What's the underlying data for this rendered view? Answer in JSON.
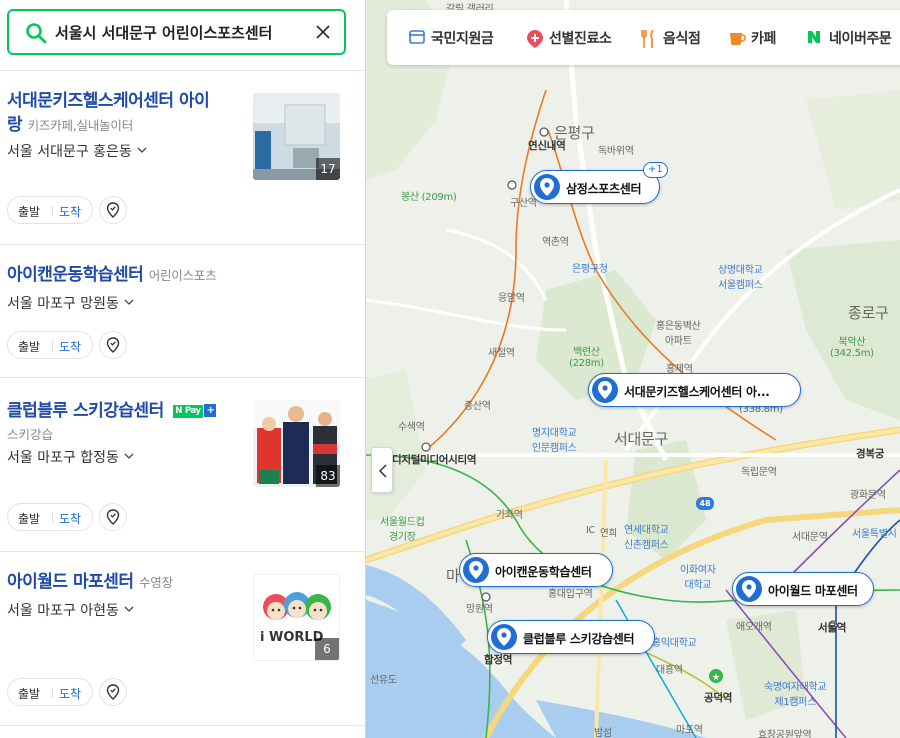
{
  "search": {
    "query": "서울시 서대문구 어린이스포츠센터"
  },
  "results": [
    {
      "title_line1": "서대문키즈헬스케어센터 아이",
      "title_line2": "랑",
      "category": "키즈카페,실내놀이터",
      "address": "서울 서대문구 홍은동",
      "depart_label": "출발",
      "arrive_label": "도착",
      "photo_count": "17"
    },
    {
      "title": "아이캔운동학습센터",
      "category": "어린이스포츠",
      "address": "서울 마포구 망원동",
      "depart_label": "출발",
      "arrive_label": "도착"
    },
    {
      "title": "클럽블루 스키강습센터",
      "npay_n": "N",
      "npay_pay": "Pay",
      "npay_plus": "+",
      "category": "스키강습",
      "address": "서울 마포구 합정동",
      "depart_label": "출발",
      "arrive_label": "도착",
      "photo_count": "83"
    },
    {
      "title": "아이월드 마포센터",
      "category": "수영장",
      "address": "서울 마포구 아현동",
      "depart_label": "출발",
      "arrive_label": "도착",
      "photo_count": "6",
      "logo_text": "i WORLD"
    }
  ],
  "categories": [
    {
      "label": "국민지원금",
      "icon": "card-icon",
      "color": "#3d7bd1"
    },
    {
      "label": "선별진료소",
      "icon": "medical-pin-icon",
      "color": "#e8505b"
    },
    {
      "label": "음식점",
      "icon": "utensils-icon",
      "color": "#f08a24"
    },
    {
      "label": "카페",
      "icon": "coffee-cup-icon",
      "color": "#f08a24"
    },
    {
      "label": "네이버주문",
      "icon": "naver-n-icon",
      "color": "#03c75a"
    }
  ],
  "markers": [
    {
      "label": "삼정스포츠센터",
      "extra": "+1"
    },
    {
      "label": "서대문키즈헬스케어센터 아..."
    },
    {
      "label": "아이캔운동학습센터"
    },
    {
      "label": "클럽블루 스키강습센터"
    },
    {
      "label": "아이월드 마포센터"
    }
  ],
  "map_labels": {
    "eunpyeong_gu": "은평구",
    "jongno_gu": "종로구",
    "seodaemun_gu": "서대문구",
    "mapo_gu": "마",
    "gallery": "갈릴 갤러리",
    "yeonsinnae": "연신내역",
    "dokbawi": "독바위역",
    "bongsan": "봉산 (209m)",
    "gusan": "구산역",
    "eungam_office": "응암역",
    "yeokchon": "역촌역",
    "eunpyeong_office": "은평구청",
    "eungam": "응암역",
    "sangmyung": "상명대학교\n서울캠퍼스",
    "bugaksan": "북악산\n(342.5m)",
    "hongje_apt": "홍은동벽산\n아파트",
    "baengnyeonsan": "백련산\n(228m)",
    "hongjeyeok": "홍제역",
    "saejeol": "새절역",
    "jeungsan": "증산역",
    "susaek": "수색역",
    "myongji": "명지대학교\n인문캠퍼스",
    "seodaemun_label": "서대문구",
    "inwangsan": "(338.8m)",
    "dongnimmun": "독립문역",
    "gyeongbokgung": "경복궁",
    "gwanghwamun": "광화문역",
    "dmc": "디지털미디어시티역",
    "seoul_world_cup": "서울월드컵\n경기장",
    "gajwa": "가좌역",
    "yeonhui_ic": "연희",
    "yonsei": "연세대학교\n신촌캠퍼스",
    "ewha": "이화여자\n대학교",
    "seodaemun_station": "서대문역",
    "seoul_museum": "서울특별시",
    "mangwon": "망원역",
    "hongik": "홍대입구역",
    "hapjeong": "합정역",
    "sinchon_stn": "신촌역",
    "aeogae": "애오개역",
    "seoul_station": "서울역",
    "hongik_univ": "홍익대학교",
    "daeheung": "대흥역",
    "gongdeok": "공덕역",
    "sookmyung": "숙명여자대학교\n제1캠퍼스",
    "seonyudo": "선유도",
    "mapo_stn": "마포역",
    "hyochang": "효창공원앞역",
    "bamseom": "밤섬",
    "route48": "48",
    "ic": "IC"
  }
}
